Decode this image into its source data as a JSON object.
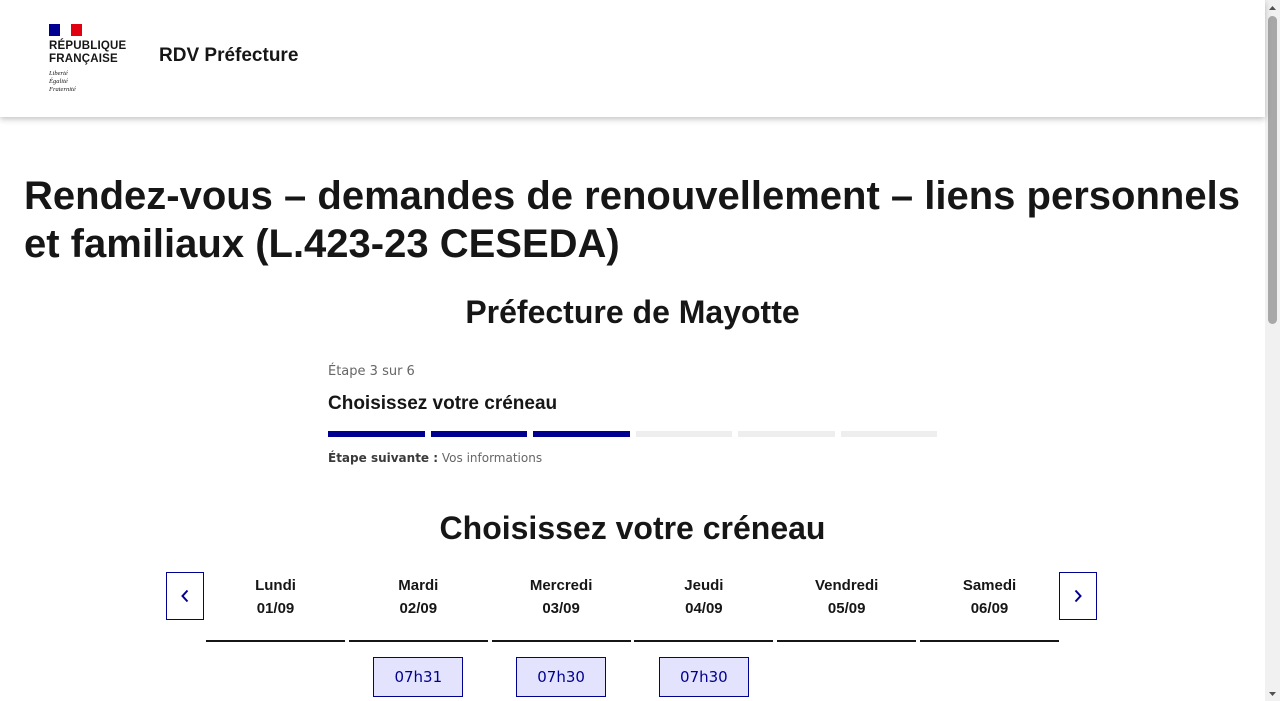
{
  "header": {
    "marianne_name": "République\nFrançaise",
    "motto": "Liberté\nÉgalité\nFraternité",
    "service_title": "RDV Préfecture",
    "flag_colors": [
      "#000091",
      "#ffffff",
      "#e1000f"
    ]
  },
  "main": {
    "title": "Rendez-vous – demandes de renouvellement – liens personnels et familiaux (L.423-23 CESEDA)",
    "prefecture": "Préfecture de Mayotte",
    "stepper": {
      "state": "Étape 3 sur 6",
      "title": "Choisissez votre créneau",
      "current_step": 3,
      "total_steps": 6,
      "next_label": "Étape suivante :",
      "next_value": "Vos informations"
    },
    "slots_title": "Choisissez votre créneau",
    "nav": {
      "prev_icon": "chevron-left-icon",
      "next_icon": "chevron-right-icon"
    },
    "days": [
      {
        "name": "Lundi",
        "date": "01/09",
        "slots": []
      },
      {
        "name": "Mardi",
        "date": "02/09",
        "slots": [
          "07h31"
        ]
      },
      {
        "name": "Mercredi",
        "date": "03/09",
        "slots": [
          "07h30"
        ]
      },
      {
        "name": "Jeudi",
        "date": "04/09",
        "slots": [
          "07h30"
        ]
      },
      {
        "name": "Vendredi",
        "date": "05/09",
        "slots": []
      },
      {
        "name": "Samedi",
        "date": "06/09",
        "slots": []
      }
    ]
  },
  "colors": {
    "accent": "#000091",
    "slot_bg": "#e3e3fd",
    "progress_inactive": "#eeeeee"
  }
}
